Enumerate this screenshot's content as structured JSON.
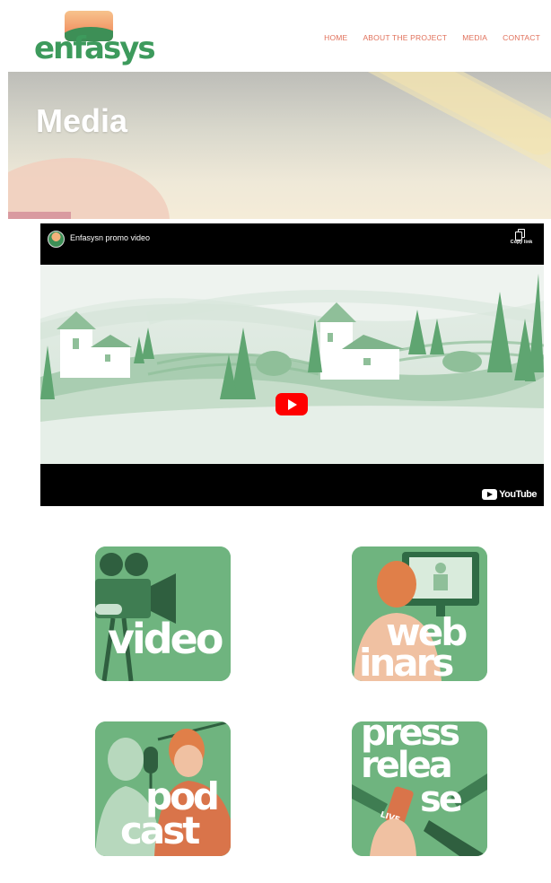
{
  "brand": {
    "logo_text": "enfasys"
  },
  "nav": {
    "items": [
      {
        "label": "HOME"
      },
      {
        "label": "ABOUT THE PROJECT"
      },
      {
        "label": "MEDIA"
      },
      {
        "label": "CONTACT"
      }
    ],
    "color": "#e0705a"
  },
  "hero": {
    "title": "Media"
  },
  "video": {
    "title": "Enfasysn promo video",
    "copy_link_label": "Copy link",
    "youtube_label": "YouTube",
    "play_icon": "youtube-play-icon"
  },
  "tiles": {
    "video": {
      "line1": "video"
    },
    "webinars": {
      "line1": "web",
      "line2": "inars"
    },
    "podcast": {
      "line1": "pod",
      "line2": "cast"
    },
    "press": {
      "line1": "press",
      "line2": "relea",
      "line3": "se"
    }
  },
  "colors": {
    "tile_green": "#6fb47f",
    "youtube_red": "#ff0000"
  }
}
